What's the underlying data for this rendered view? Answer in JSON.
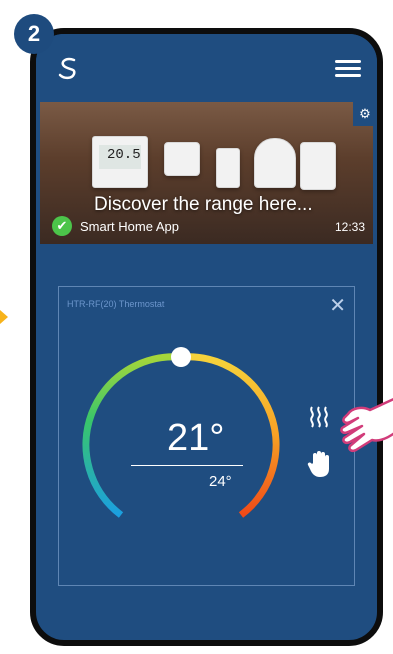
{
  "step_number": "2",
  "topbar": {
    "logo": "salus-logo",
    "menu_icon": "hamburger-menu-icon"
  },
  "banner": {
    "device_display": "20.5",
    "title": "Discover the range here...",
    "app_name": "Smart Home App",
    "time": "12:33"
  },
  "card": {
    "title": "HTR-RF(20) Thermostat",
    "current_temp": "21°",
    "set_temp": "24°",
    "heat_icon": "heat-icon",
    "manual_icon": "hand-icon"
  },
  "colors": {
    "app_background": "#1f4d80",
    "badge": "#1e4b7e",
    "check": "#4cc44a",
    "dial_start": "#14a0e0",
    "dial_end": "#f04a18"
  }
}
